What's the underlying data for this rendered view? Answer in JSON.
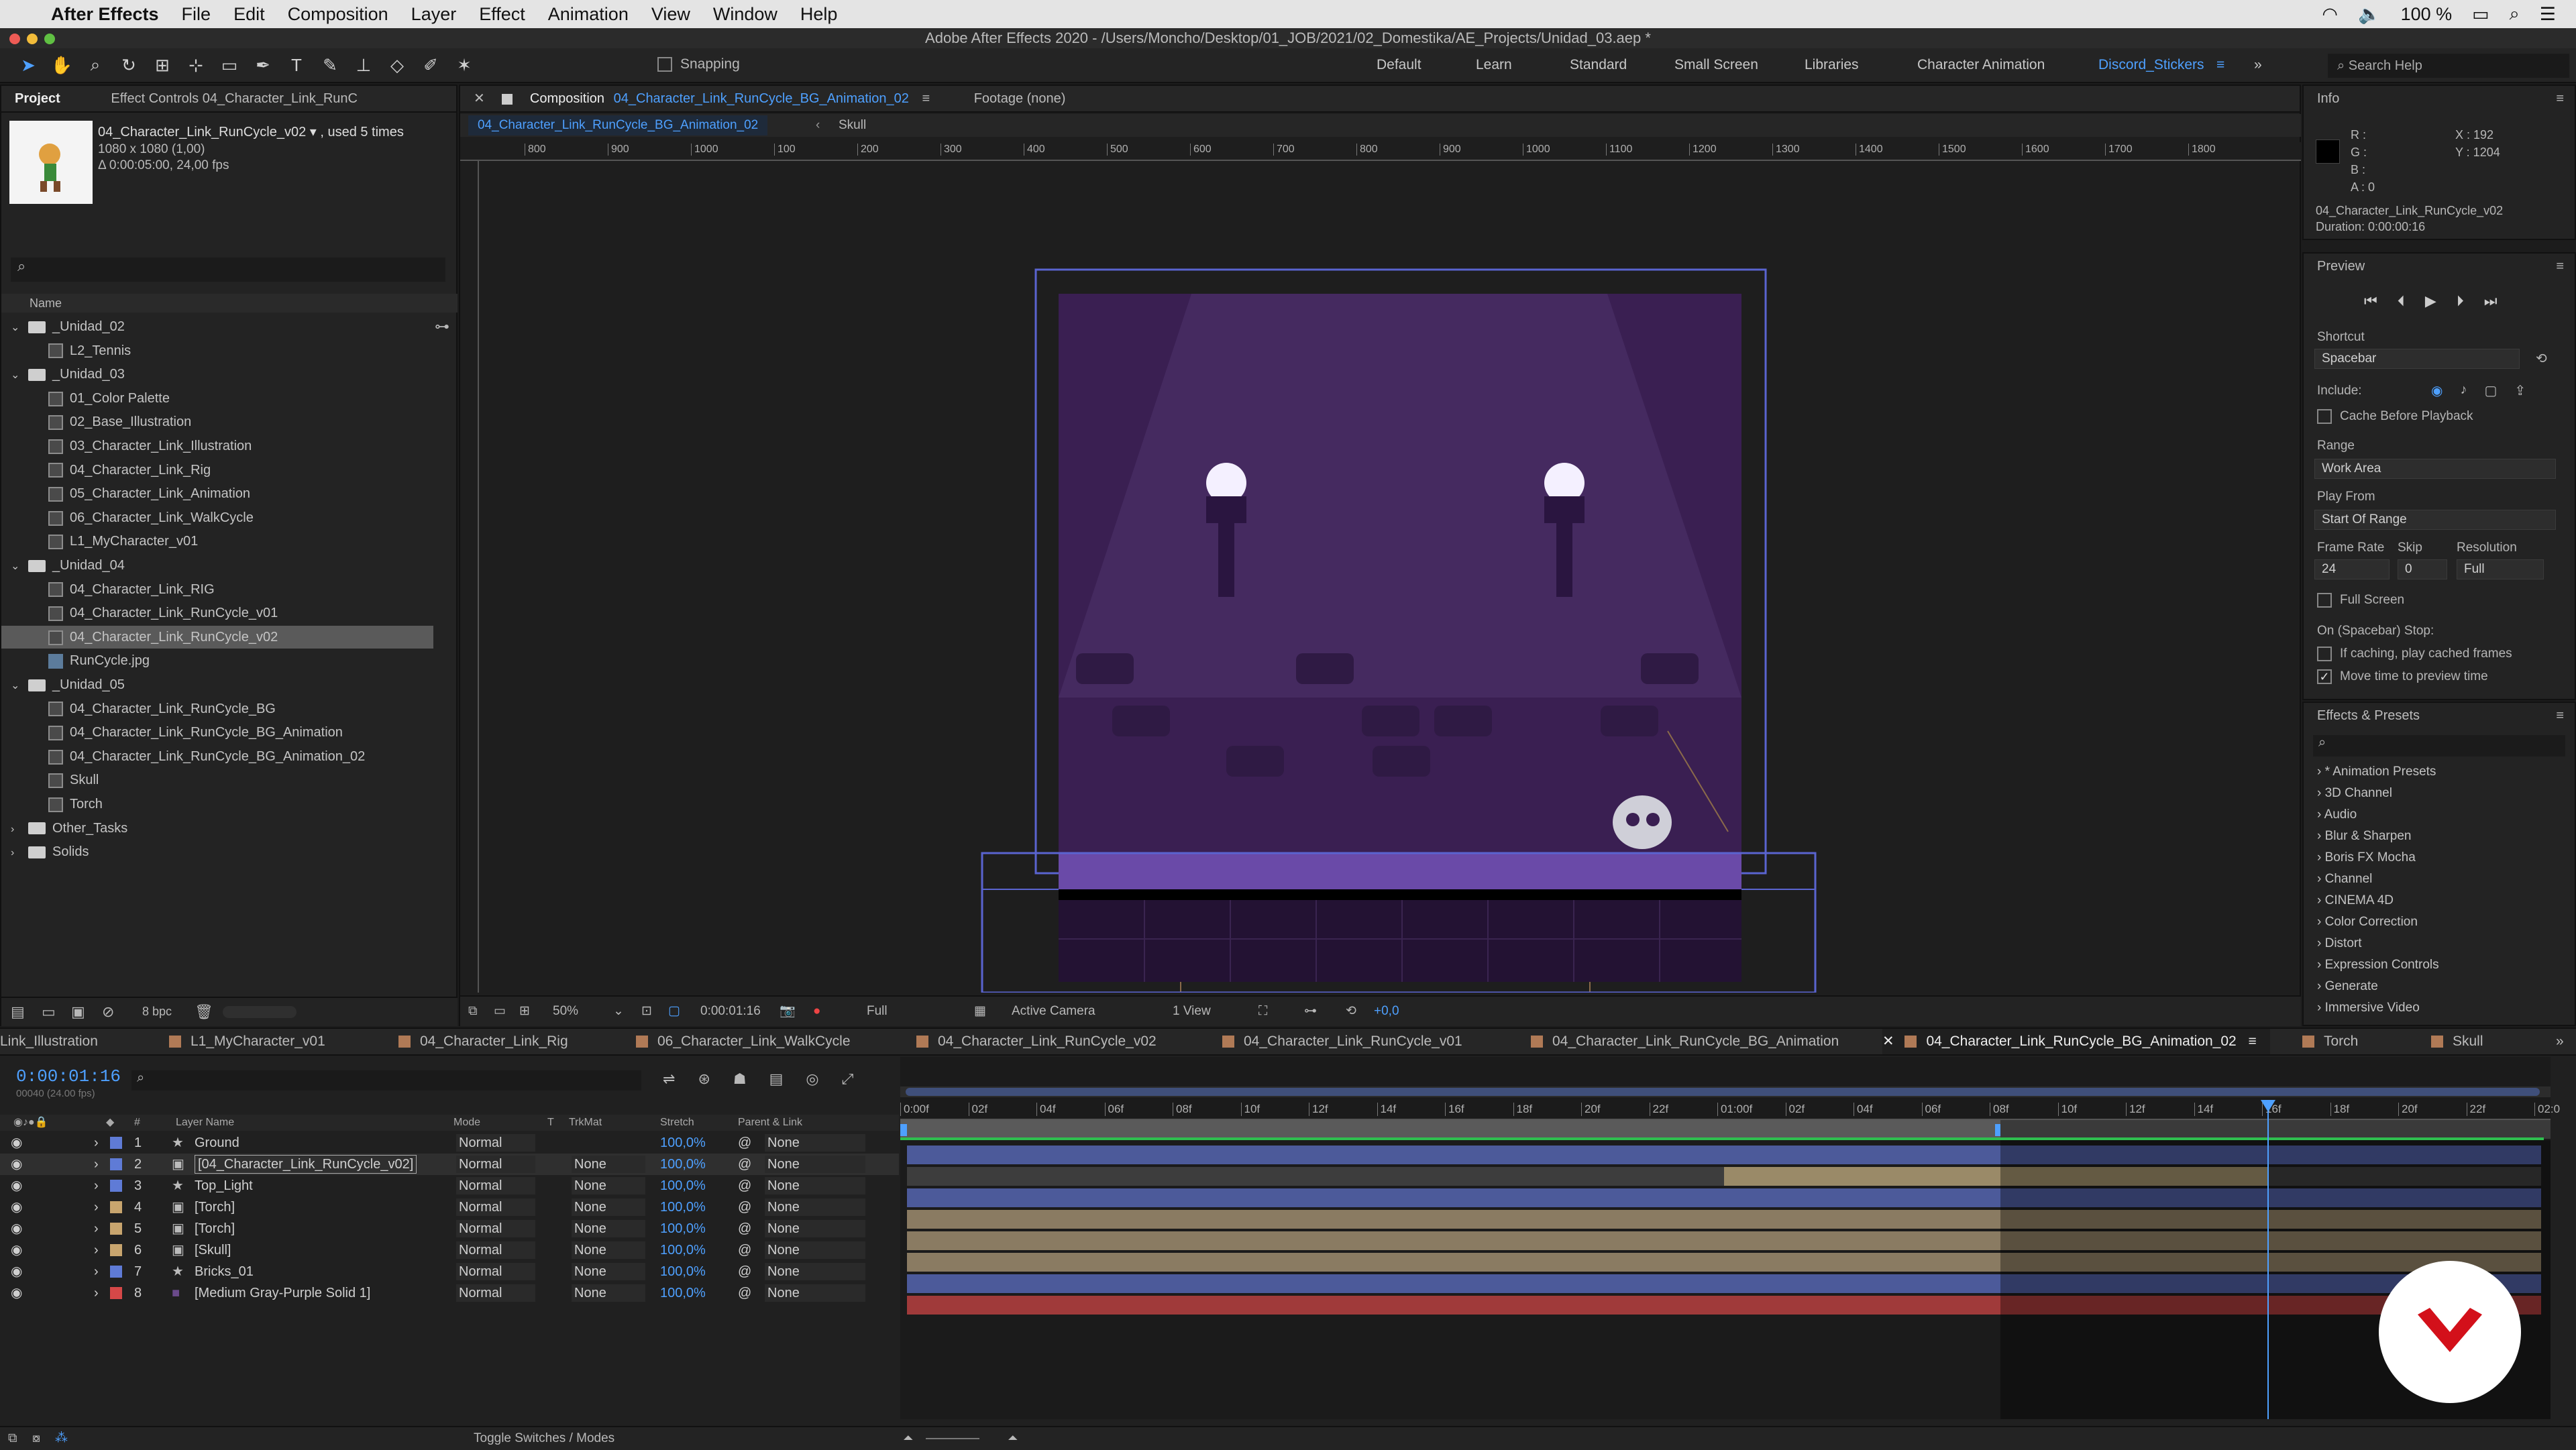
{
  "menubar": {
    "app": "After Effects",
    "items": [
      "File",
      "Edit",
      "Composition",
      "Layer",
      "Effect",
      "Animation",
      "View",
      "Window",
      "Help"
    ],
    "battery": "100 %"
  },
  "window_title": "Adobe After Effects 2020 - /Users/Moncho/Desktop/01_JOB/2021/02_Domestika/AE_Projects/Unidad_03.aep *",
  "toolbar": {
    "snapping": "Snapping",
    "workspaces": [
      "Default",
      "Learn",
      "Standard",
      "Small Screen",
      "Libraries",
      "Character Animation",
      "Discord_Stickers"
    ],
    "search": "Search Help"
  },
  "project": {
    "tab_project": "Project",
    "tab_effects": "Effect Controls 04_Character_Link_RunC",
    "item_name": "04_Character_Link_RunCycle_v02 ▾ , used 5 times",
    "item_size": "1080 x 1080 (1,00)",
    "item_duration": "Δ 0:00:05:00, 24,00 fps",
    "col_name": "Name",
    "tree": [
      {
        "label": "_Unidad_02",
        "type": "folder",
        "indent": 0,
        "open": true
      },
      {
        "label": "L2_Tennis",
        "type": "comp",
        "indent": 1
      },
      {
        "label": "_Unidad_03",
        "type": "folder",
        "indent": 0,
        "open": true
      },
      {
        "label": "01_Color Palette",
        "type": "comp",
        "indent": 1
      },
      {
        "label": "02_Base_Illustration",
        "type": "comp",
        "indent": 1
      },
      {
        "label": "03_Character_Link_Illustration",
        "type": "comp",
        "indent": 1
      },
      {
        "label": "04_Character_Link_Rig",
        "type": "comp",
        "indent": 1
      },
      {
        "label": "05_Character_Link_Animation",
        "type": "comp",
        "indent": 1
      },
      {
        "label": "06_Character_Link_WalkCycle",
        "type": "comp",
        "indent": 1
      },
      {
        "label": "L1_MyCharacter_v01",
        "type": "comp",
        "indent": 1
      },
      {
        "label": "_Unidad_04",
        "type": "folder",
        "indent": 0,
        "open": true
      },
      {
        "label": "04_Character_Link_RIG",
        "type": "comp",
        "indent": 1
      },
      {
        "label": "04_Character_Link_RunCycle_v01",
        "type": "comp",
        "indent": 1
      },
      {
        "label": "04_Character_Link_RunCycle_v02",
        "type": "comp",
        "indent": 1,
        "selected": true
      },
      {
        "label": "RunCycle.jpg",
        "type": "img",
        "indent": 1
      },
      {
        "label": "_Unidad_05",
        "type": "folder",
        "indent": 0,
        "open": true
      },
      {
        "label": "04_Character_Link_RunCycle_BG",
        "type": "comp",
        "indent": 1
      },
      {
        "label": "04_Character_Link_RunCycle_BG_Animation",
        "type": "comp",
        "indent": 1
      },
      {
        "label": "04_Character_Link_RunCycle_BG_Animation_02",
        "type": "comp",
        "indent": 1
      },
      {
        "label": "Skull",
        "type": "comp",
        "indent": 1
      },
      {
        "label": "Torch",
        "type": "comp",
        "indent": 1
      },
      {
        "label": "Other_Tasks",
        "type": "folder",
        "indent": 0,
        "open": false
      },
      {
        "label": "Solids",
        "type": "folder",
        "indent": 0,
        "open": false
      }
    ],
    "bpc": "8 bpc"
  },
  "comp": {
    "tab_label": "Composition",
    "tab_name": "04_Character_Link_RunCycle_BG_Animation_02",
    "footage": "Footage (none)",
    "crumb1": "04_Character_Link_RunCycle_BG_Animation_02",
    "crumb2": "Skull",
    "ruler": [
      "800",
      "900",
      "1000",
      "100",
      "200",
      "300",
      "400",
      "500",
      "600",
      "700",
      "800",
      "900",
      "1000",
      "1100",
      "1200",
      "1300",
      "1400",
      "1500",
      "1600",
      "1700",
      "1800"
    ],
    "zoom": "50%",
    "time": "0:00:01:16",
    "resolution": "Full",
    "camera": "Active Camera",
    "views": "1 View",
    "exposure": "+0,0"
  },
  "info": {
    "title": "Info",
    "r": "R :",
    "g": "G :",
    "b": "B :",
    "a": "A : 0",
    "x": "X : 192",
    "y": "Y : 1204",
    "name": "04_Character_Link_RunCycle_v02",
    "duration": "Duration: 0:00:00:16"
  },
  "preview": {
    "title": "Preview",
    "shortcut_label": "Shortcut",
    "shortcut": "Spacebar",
    "include": "Include:",
    "cache": "Cache Before Playback",
    "range_label": "Range",
    "range": "Work Area",
    "playfrom_label": "Play From",
    "playfrom": "Start Of Range",
    "fr_label": "Frame Rate",
    "skip_label": "Skip",
    "res_label": "Resolution",
    "fr": "24",
    "skip": "0",
    "res": "Full",
    "fullscreen": "Full Screen",
    "stop_label": "On (Spacebar) Stop:",
    "opt1": "If caching, play cached frames",
    "opt2": "Move time to preview time"
  },
  "effects": {
    "title": "Effects & Presets",
    "items": [
      "* Animation Presets",
      "3D Channel",
      "Audio",
      "Blur & Sharpen",
      "Boris FX Mocha",
      "Channel",
      "CINEMA 4D",
      "Color Correction",
      "Distort",
      "Expression Controls",
      "Generate",
      "Immersive Video"
    ]
  },
  "timeline": {
    "tabs": [
      {
        "label": "Link_Illustration",
        "color": "#b07a56"
      },
      {
        "label": "L1_MyCharacter_v01",
        "color": "#b07a56"
      },
      {
        "label": "04_Character_Link_Rig",
        "color": "#b07a56"
      },
      {
        "label": "06_Character_Link_WalkCycle",
        "color": "#b07a56"
      },
      {
        "label": "04_Character_Link_RunCycle_v02",
        "color": "#b07a56"
      },
      {
        "label": "04_Character_Link_RunCycle_v01",
        "color": "#b07a56"
      },
      {
        "label": "04_Character_Link_RunCycle_BG_Animation",
        "color": "#b07a56"
      },
      {
        "label": "04_Character_Link_RunCycle_BG_Animation_02",
        "color": "#b07a56",
        "active": true
      },
      {
        "label": "Torch",
        "color": "#b07a56"
      },
      {
        "label": "Skull",
        "color": "#b07a56"
      }
    ],
    "timecode": "0:00:01:16",
    "frames": "00040 (24.00 fps)",
    "headers": {
      "num": "#",
      "name": "Layer Name",
      "mode": "Mode",
      "t": "T",
      "trkmat": "TrkMat",
      "stretch": "Stretch",
      "parent": "Parent & Link"
    },
    "layers": [
      {
        "n": "1",
        "name": "Ground",
        "mode": "Normal",
        "trk": "",
        "stretch": "100,0%",
        "parent": "None",
        "color": "#5f7bd6",
        "kind": "shape"
      },
      {
        "n": "2",
        "name": "[04_Character_Link_RunCycle_v02]",
        "mode": "Normal",
        "trk": "None",
        "stretch": "100,0%",
        "parent": "None",
        "color": "#5f7bd6",
        "kind": "comp",
        "selected": true
      },
      {
        "n": "3",
        "name": "Top_Light",
        "mode": "Normal",
        "trk": "None",
        "stretch": "100,0%",
        "parent": "None",
        "color": "#5f7bd6",
        "kind": "shape"
      },
      {
        "n": "4",
        "name": "[Torch]",
        "mode": "Normal",
        "trk": "None",
        "stretch": "100,0%",
        "parent": "None",
        "color": "#c8a56e",
        "kind": "comp"
      },
      {
        "n": "5",
        "name": "[Torch]",
        "mode": "Normal",
        "trk": "None",
        "stretch": "100,0%",
        "parent": "None",
        "color": "#c8a56e",
        "kind": "comp"
      },
      {
        "n": "6",
        "name": "[Skull]",
        "mode": "Normal",
        "trk": "None",
        "stretch": "100,0%",
        "parent": "None",
        "color": "#c8a56e",
        "kind": "comp"
      },
      {
        "n": "7",
        "name": "Bricks_01",
        "mode": "Normal",
        "trk": "None",
        "stretch": "100,0%",
        "parent": "None",
        "color": "#5f7bd6",
        "kind": "shape"
      },
      {
        "n": "8",
        "name": "[Medium Gray-Purple Solid 1]",
        "mode": "Normal",
        "trk": "None",
        "stretch": "100,0%",
        "parent": "None",
        "color": "#d64848",
        "kind": "solid"
      }
    ],
    "ruler": [
      "0:00f",
      "02f",
      "04f",
      "06f",
      "08f",
      "10f",
      "12f",
      "14f",
      "16f",
      "18f",
      "20f",
      "22f",
      "01:00f",
      "02f",
      "04f",
      "06f",
      "08f",
      "10f",
      "12f",
      "14f",
      "16f",
      "18f",
      "20f",
      "22f",
      "02:0"
    ],
    "toggle": "Toggle Switches / Modes"
  }
}
